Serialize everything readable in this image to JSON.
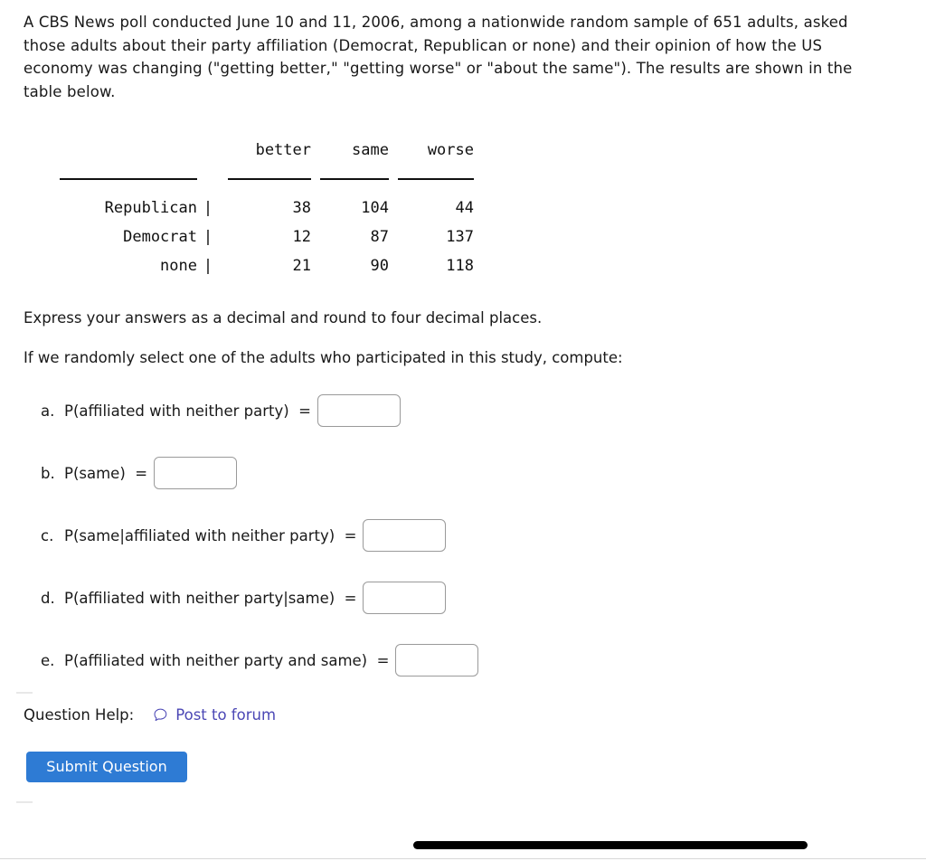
{
  "intro": {
    "paragraph": "A CBS News poll conducted June 10 and 11, 2006, among a nationwide random sample of 651 adults, asked those adults about their party affiliation (Democrat, Republican or none) and their opinion of how the US economy was changing (\"getting better,\" \"getting worse\" or \"about the same\"). The results are shown in the table below."
  },
  "table": {
    "columns": [
      "better",
      "same",
      "worse"
    ],
    "rows": [
      {
        "label": "Republican",
        "values": [
          "38",
          "104",
          "44"
        ]
      },
      {
        "label": "Democrat",
        "values": [
          "12",
          "87",
          "137"
        ]
      },
      {
        "label": "none",
        "values": [
          "21",
          "90",
          "118"
        ]
      }
    ],
    "divider": "|"
  },
  "prompts": {
    "decimal": "Express your answers as a decimal and round to four decimal places.",
    "compute": "If we randomly select one of the adults who participated in this study, compute:"
  },
  "questions": [
    {
      "marker": "a.",
      "label": "P(affiliated with neither party)  =",
      "value": "",
      "placeholder": ""
    },
    {
      "marker": "b.",
      "label": "P(same)  =",
      "value": "",
      "placeholder": ""
    },
    {
      "marker": "c.",
      "label": "P(same|affiliated with neither party)  =",
      "value": "",
      "placeholder": ""
    },
    {
      "marker": "d.",
      "label": "P(affiliated with neither party|same)  =",
      "value": "",
      "placeholder": ""
    },
    {
      "marker": "e.",
      "label": "P(affiliated with neither party and same)  =",
      "value": "",
      "placeholder": ""
    }
  ],
  "help": {
    "label": "Question Help:",
    "link_text": "Post to forum",
    "icon": "speech-bubble-icon",
    "link_color": "#4b47b5"
  },
  "submit": {
    "label": "Submit Question",
    "color": "#2e7bd4",
    "text_color": "#ffffff"
  }
}
